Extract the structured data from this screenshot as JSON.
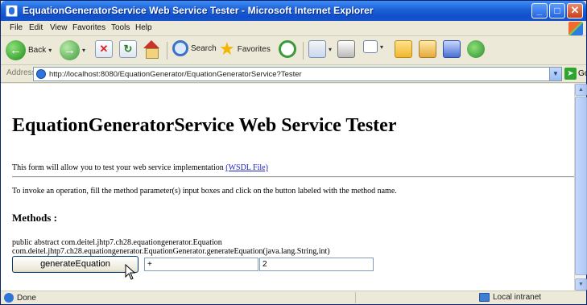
{
  "window": {
    "title": "EquationGeneratorService Web Service Tester - Microsoft Internet Explorer",
    "min_glyph": "_",
    "max_glyph": "□",
    "close_glyph": "✕"
  },
  "menu": [
    "File",
    "Edit",
    "View",
    "Favorites",
    "Tools",
    "Help"
  ],
  "toolbar": {
    "back_label": "Back",
    "search_label": "Search",
    "favorites_label": "Favorites"
  },
  "address": {
    "label": "Address",
    "url": "http://localhost:8080/EquationGenerator/EquationGeneratorService?Tester",
    "go_label": "Go"
  },
  "page": {
    "title": "EquationGeneratorService Web Service Tester",
    "intro_text": "This form will allow you to test your web service implementation",
    "wsdl_link": "(WSDL File)",
    "instructions": "To invoke an operation, fill the method parameter(s) input boxes and click on the button labeled with the method name.",
    "methods_heading": "Methods :",
    "signature_line1": "public abstract com.deitel.jhtp7.ch28.equationgenerator.Equation",
    "signature_line2": "com.deitel.jhtp7.ch28.equationgenerator.EquationGenerator.generateEquation(java.lang.String,int)",
    "method_button": "generateEquation",
    "param1_value": "+",
    "param2_value": "2"
  },
  "status": {
    "text": "Done",
    "zone": "Local intranet"
  },
  "colors": {
    "titlebar": "#1f63d8",
    "link": "#2222cc",
    "chrome": "#ece9d8"
  }
}
